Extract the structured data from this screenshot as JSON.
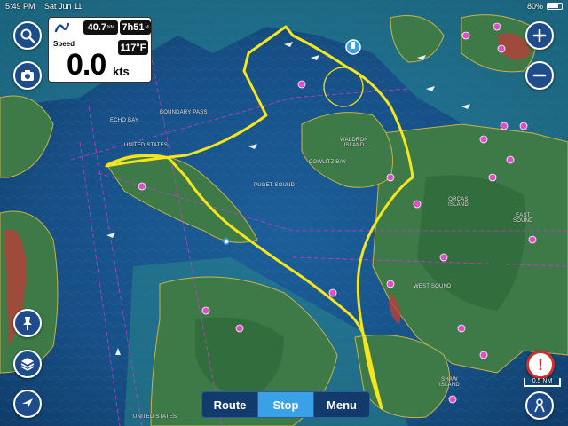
{
  "status_bar": {
    "time": "5:49 PM",
    "date": "Sat Jun 11",
    "battery_text": "80%",
    "battery_level_percent": 80
  },
  "instrument": {
    "distance_value": "40.7",
    "distance_unit": "NM",
    "eta_value": "7h51",
    "eta_unit": "M",
    "temperature": "117°F",
    "speed_label": "Speed",
    "speed_value": "0.0",
    "speed_unit": "kts"
  },
  "route_controls": {
    "route_label": "Route",
    "stop_label": "Stop",
    "menu_label": "Menu",
    "active": "Stop"
  },
  "scale_label": "0.5 NM",
  "warning_symbol": "!",
  "map_labels": {
    "boundary_pass": "BOUNDARY PASS",
    "echo_bay": "ECHO BAY",
    "united_states_1": "UNITED STATES",
    "united_states_2": "UNITED STATES",
    "waldron_island": "WALDRON\nISLAND",
    "cowlitz_bay": "COWLITZ BAY",
    "orcas_island": "ORCAS\nISLAND",
    "east_sound": "EAST\nSOUND",
    "west_sound": "WEST SOUND",
    "shaw_island": "SHAW\nISLAND",
    "puget_sound": "PUGET SOUND"
  },
  "colors": {
    "route_line": "#f5e51c",
    "button_blue": "#1e4c8a",
    "active_segment": "#3aa0e8",
    "deep_water": "#0e3f6e",
    "land_green": "#3a7a45",
    "warning_red": "#d0312d"
  },
  "icons": {
    "search": "search-icon",
    "camera": "camera-icon",
    "pin": "pin-icon",
    "layers": "layers-icon",
    "locate": "location-arrow-icon",
    "zoom_in": "plus-icon",
    "zoom_out": "minus-icon",
    "warning": "warning-icon",
    "person": "person-icon",
    "logo": "navionics-logo-icon"
  }
}
